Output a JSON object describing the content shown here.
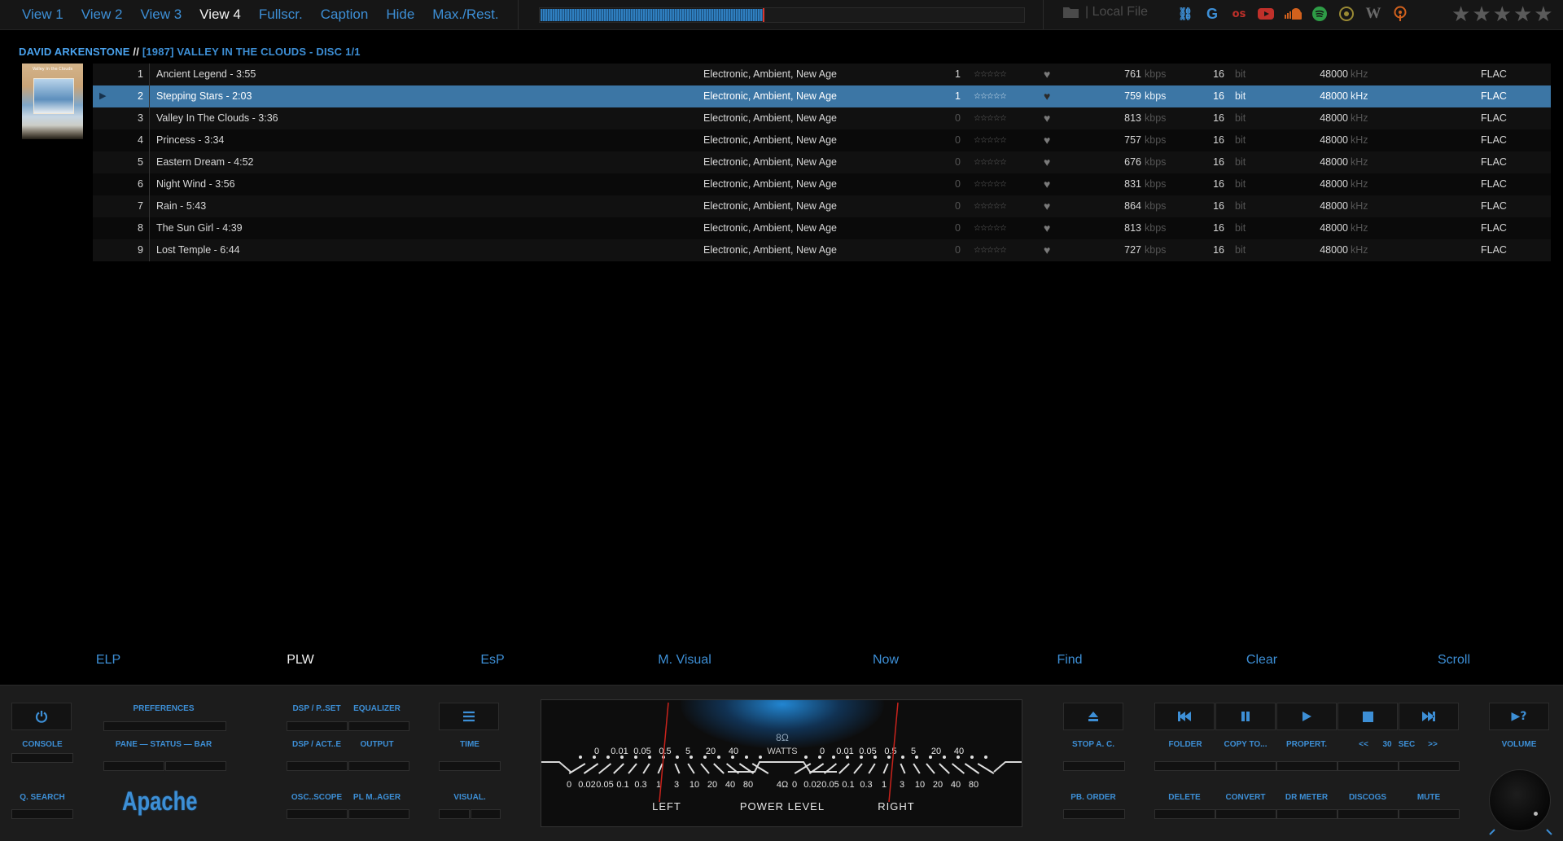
{
  "topbar": {
    "nav": [
      "View 1",
      "View 2",
      "View 3",
      "View 4",
      "Fullscr.",
      "Caption",
      "Hide",
      "Max./Rest."
    ],
    "active_nav": "View 4",
    "seek_progress": 0.46,
    "local_file_label": "| Local File",
    "source_icons": [
      "link-icon",
      "google-icon",
      "lastfm-icon",
      "youtube-icon",
      "soundcloud-icon",
      "spotify-icon",
      "discogs-icon",
      "wikipedia-icon",
      "podcast-icon"
    ],
    "rating_stars": 5
  },
  "album": {
    "artist": "DAVID ARKENSTONE",
    "separator": "//",
    "title": "[1987] VALLEY IN THE CLOUDS - DISC 1/1",
    "cover_text": "Valley in the Clouds"
  },
  "tracks": [
    {
      "num": "1",
      "title": "Ancient Legend - 3:55",
      "genre": "Electronic, Ambient, New Age",
      "plays": "1",
      "kbps": "761",
      "bit": "16",
      "khz": "48000",
      "format": "FLAC",
      "selected": false
    },
    {
      "num": "2",
      "title": "Stepping Stars - 2:03",
      "genre": "Electronic, Ambient, New Age",
      "plays": "1",
      "kbps": "759",
      "bit": "16",
      "khz": "48000",
      "format": "FLAC",
      "selected": true
    },
    {
      "num": "3",
      "title": "Valley In The Clouds - 3:36",
      "genre": "Electronic, Ambient, New Age",
      "plays": "0",
      "kbps": "813",
      "bit": "16",
      "khz": "48000",
      "format": "FLAC",
      "selected": false
    },
    {
      "num": "4",
      "title": "Princess - 3:34",
      "genre": "Electronic, Ambient, New Age",
      "plays": "0",
      "kbps": "757",
      "bit": "16",
      "khz": "48000",
      "format": "FLAC",
      "selected": false
    },
    {
      "num": "5",
      "title": "Eastern Dream - 4:52",
      "genre": "Electronic, Ambient, New Age",
      "plays": "0",
      "kbps": "676",
      "bit": "16",
      "khz": "48000",
      "format": "FLAC",
      "selected": false
    },
    {
      "num": "6",
      "title": "Night Wind - 3:56",
      "genre": "Electronic, Ambient, New Age",
      "plays": "0",
      "kbps": "831",
      "bit": "16",
      "khz": "48000",
      "format": "FLAC",
      "selected": false
    },
    {
      "num": "7",
      "title": "Rain - 5:43",
      "genre": "Electronic, Ambient, New Age",
      "plays": "0",
      "kbps": "864",
      "bit": "16",
      "khz": "48000",
      "format": "FLAC",
      "selected": false
    },
    {
      "num": "8",
      "title": "The Sun Girl - 4:39",
      "genre": "Electronic, Ambient, New Age",
      "plays": "0",
      "kbps": "813",
      "bit": "16",
      "khz": "48000",
      "format": "FLAC",
      "selected": false
    },
    {
      "num": "9",
      "title": "Lost Temple - 6:44",
      "genre": "Electronic, Ambient, New Age",
      "plays": "0",
      "kbps": "727",
      "bit": "16",
      "khz": "48000",
      "format": "FLAC",
      "selected": false
    }
  ],
  "units": {
    "kbps": "kbps",
    "bit": "bit",
    "khz": "kHz",
    "rating": "☆☆☆☆☆"
  },
  "bottom_links": [
    "ELP",
    "PLW",
    "EsP",
    "M. Visual",
    "Now",
    "Find",
    "Clear",
    "Scroll"
  ],
  "active_bottom_link": "PLW",
  "panel": {
    "console": "CONSOLE",
    "q_search": "Q. SEARCH",
    "preferences": "PREFERENCES",
    "pane_status_bar": "PANE — STATUS — BAR",
    "brand": "Apache",
    "dsp_preset": "DSP / P..SET",
    "equalizer": "EQUALIZER",
    "dsp_active": "DSP / ACT..E",
    "output": "OUTPUT",
    "oscilloscope": "OSC..SCOPE",
    "pl_manager": "PL M..AGER",
    "time": "TIME",
    "visual": "VISUAL.",
    "stop_ac": "STOP A. C.",
    "pb_order": "PB. ORDER",
    "folder": "FOLDER",
    "copy_to": "COPY TO...",
    "properties": "PROPERT.",
    "seek_back": "<<",
    "seek_seconds": "30",
    "seek_unit": "SEC",
    "seek_fwd": ">>",
    "delete": "DELETE",
    "convert": "CONVERT",
    "dr_meter": "DR METER",
    "discogs": "DISCOGS",
    "mute": "MUTE",
    "volume": "VOLUME",
    "help_glyph": "▶?"
  },
  "vu": {
    "top_scale": [
      "0",
      "0.01",
      "0.05",
      "0.5",
      "5",
      "20",
      "40"
    ],
    "bottom_scale": [
      "0",
      "0.02",
      "0.05",
      "0.1",
      "0.3",
      "1",
      "3",
      "10",
      "20",
      "40",
      "80"
    ],
    "center_top": "8Ω",
    "center_mid": "WATTS",
    "center_bottom": "4Ω",
    "left_label": "LEFT",
    "power_level": "POWER  LEVEL",
    "right_label": "RIGHT"
  }
}
